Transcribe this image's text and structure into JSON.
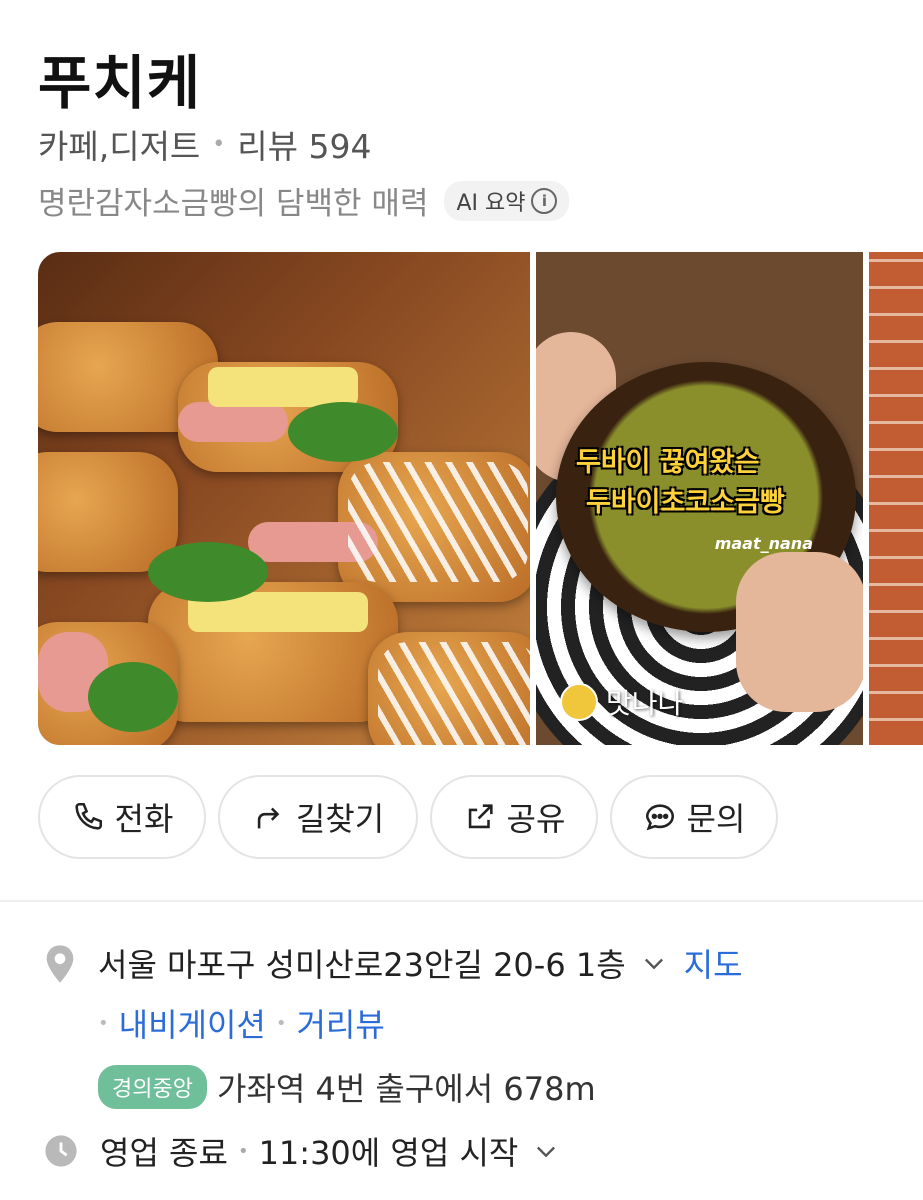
{
  "place": {
    "name": "푸치케",
    "category": "카페,디저트",
    "review_label": "리뷰 594",
    "summary": "명란감자소금빵의 담백한 매력",
    "ai_badge": "AI 요약"
  },
  "photos": {
    "photo2_overlay_line1": "두바이 끊여왔슨",
    "photo2_overlay_line2": "두바이초코소금빵",
    "photo2_watermark": "maat_nana",
    "photo2_creator": "맛나나"
  },
  "actions": [
    {
      "label": "전화",
      "icon": "phone-icon"
    },
    {
      "label": "길찾기",
      "icon": "route-arrow-icon"
    },
    {
      "label": "공유",
      "icon": "share-icon"
    },
    {
      "label": "문의",
      "icon": "chat-icon"
    }
  ],
  "address": {
    "text": "서울 마포구 성미산로23안길 20-6 1층",
    "map_link": "지도",
    "navigation_link": "내비게이션",
    "streetview_link": "거리뷰",
    "subway_line": "경의중앙",
    "subway_text": "가좌역 4번 출구에서 678m"
  },
  "hours": {
    "status": "영업 종료",
    "next": "11:30에 영업 시작"
  },
  "colors": {
    "link": "#2b6cd9",
    "subway_line": "#6fbf9a"
  }
}
